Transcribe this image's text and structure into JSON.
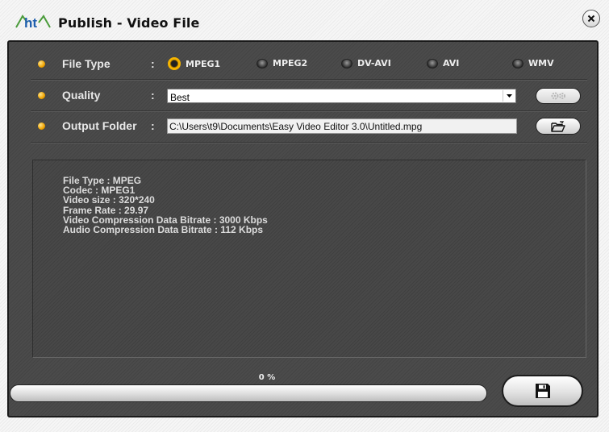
{
  "window": {
    "logo_text": "ht",
    "title": "Publish - Video File",
    "close_icon": "close-icon"
  },
  "file_type": {
    "label": "File Type",
    "separator": ":",
    "options": [
      {
        "label": "MPEG1",
        "selected": true
      },
      {
        "label": "MPEG2",
        "selected": false
      },
      {
        "label": "DV-AVI",
        "selected": false
      },
      {
        "label": "AVI",
        "selected": false
      },
      {
        "label": "WMV",
        "selected": false
      }
    ]
  },
  "quality": {
    "label": "Quality",
    "separator": ":",
    "value": "Best",
    "settings_icon": "gear-icon",
    "settings_enabled": false
  },
  "output_folder": {
    "label": "Output Folder",
    "separator": ":",
    "path": "C:\\Users\\t9\\Documents\\Easy Video Editor 3.0\\Untitled.mpg",
    "browse_icon": "folder-open-icon"
  },
  "info": {
    "lines": [
      "File Type : MPEG",
      "Codec : MPEG1",
      "Video size : 320*240",
      "Frame Rate : 29.97",
      "Video Compression Data Bitrate : 3000 Kbps",
      "Audio Compression Data Bitrate : 112 Kbps"
    ]
  },
  "progress": {
    "label": "0 %",
    "percent": 0
  },
  "save": {
    "icon": "save-icon"
  },
  "colors": {
    "accent": "#f5b400",
    "panel": "#484848"
  }
}
